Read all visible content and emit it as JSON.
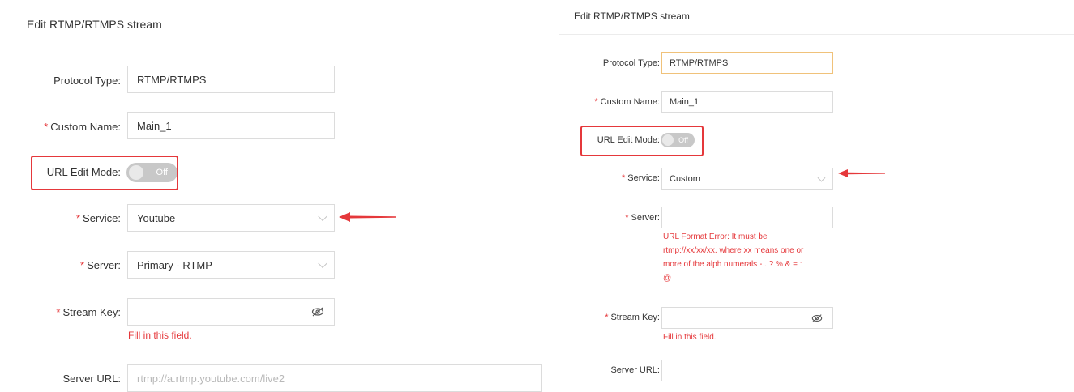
{
  "left": {
    "title": "Edit RTMP/RTMPS stream",
    "protocol_type_label": "Protocol Type:",
    "protocol_type_value": "RTMP/RTMPS",
    "custom_name_label": "Custom Name:",
    "custom_name_value": "Main_1",
    "url_edit_mode_label": "URL Edit Mode:",
    "url_edit_mode_state": "Off",
    "service_label": "Service:",
    "service_value": "Youtube",
    "server_label": "Server:",
    "server_value": "Primary - RTMP",
    "stream_key_label": "Stream Key:",
    "stream_key_value": "",
    "stream_key_error": "Fill in this field.",
    "server_url_label": "Server URL:",
    "server_url_placeholder": "rtmp://a.rtmp.youtube.com/live2"
  },
  "right": {
    "title": "Edit RTMP/RTMPS stream",
    "protocol_type_label": "Protocol Type:",
    "protocol_type_value": "RTMP/RTMPS",
    "custom_name_label": "Custom Name:",
    "custom_name_value": "Main_1",
    "url_edit_mode_label": "URL Edit Mode:",
    "url_edit_mode_state": "Off",
    "service_label": "Service:",
    "service_value": "Custom",
    "server_label": "Server:",
    "server_value": "",
    "server_error_lines": [
      "URL Format Error: It must be",
      "rtmp://xx/xx/xx. where xx means one or",
      "more of the alph numerals - . ? % & = :",
      "@"
    ],
    "stream_key_label": "Stream Key:",
    "stream_key_value": "",
    "stream_key_error": "Fill in this field.",
    "server_url_label": "Server URL:",
    "server_url_value": ""
  },
  "required_marker": "*",
  "colors": {
    "required": "#e5383b",
    "highlight": "#e5383b",
    "toggle_off": "#c8c8c8",
    "focus_border": "#f0c27a"
  },
  "icons": {
    "dropdown": "chevron-down-icon",
    "hide_password": "eye-off-icon",
    "annotation": "red-arrow-icon"
  }
}
